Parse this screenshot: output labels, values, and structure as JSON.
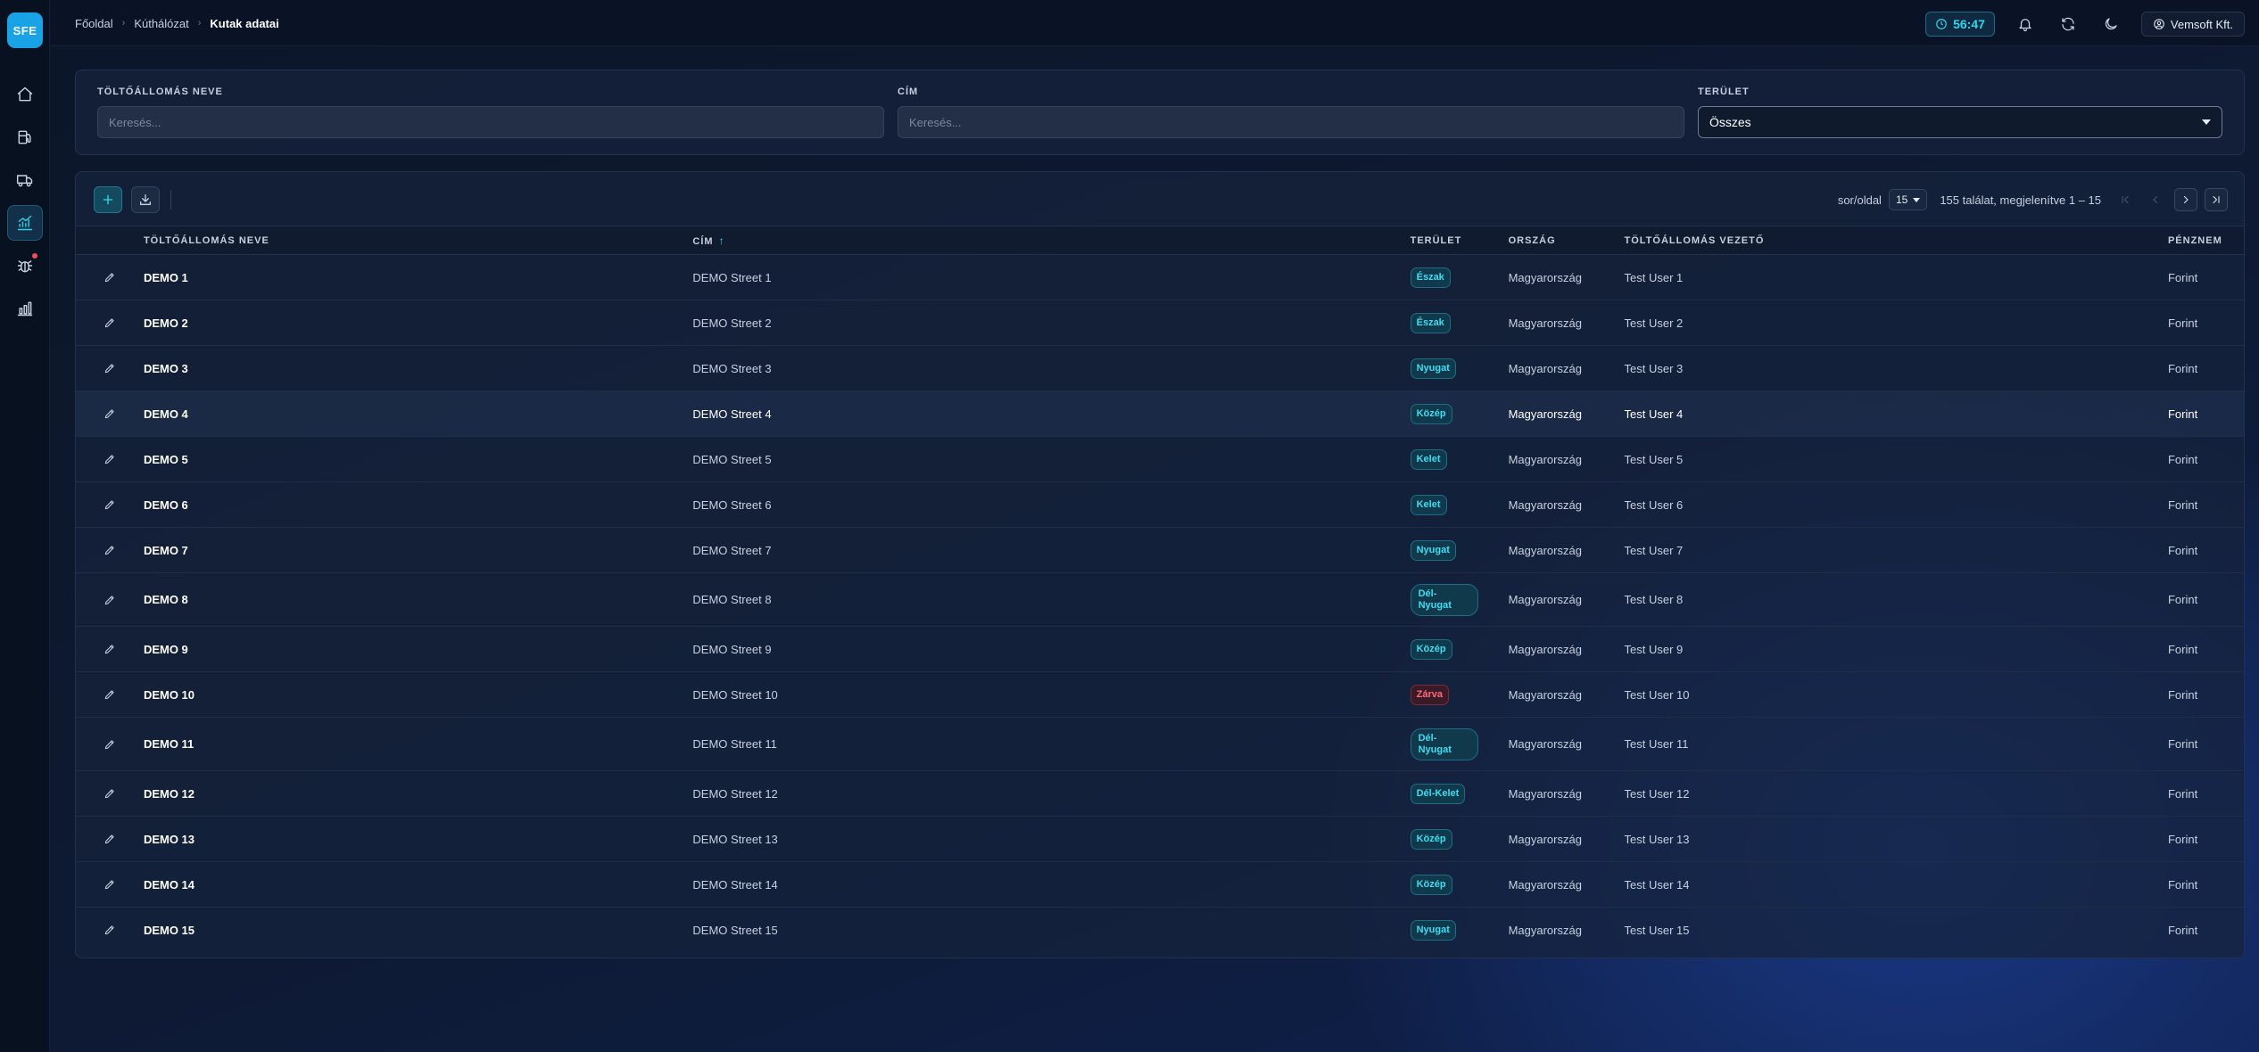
{
  "app": {
    "logo_text": "SFE"
  },
  "sidebar": {
    "items": [
      {
        "icon": "home-icon"
      },
      {
        "icon": "fuel-pump-icon"
      },
      {
        "icon": "truck-icon"
      },
      {
        "icon": "chart-up-icon",
        "active": true
      },
      {
        "icon": "bug-icon",
        "notification": true
      },
      {
        "icon": "bar-chart-icon"
      }
    ]
  },
  "header": {
    "breadcrumb": [
      "Főoldal",
      "Kúthálózat",
      "Kutak adatai"
    ],
    "timer": "56:47",
    "company": "Vemsoft Kft."
  },
  "filters": {
    "station_name": {
      "label": "Töltőállomás neve",
      "placeholder": "Keresés..."
    },
    "address": {
      "label": "Cím",
      "placeholder": "Keresés..."
    },
    "area": {
      "label": "Terület",
      "value": "Összes"
    }
  },
  "toolbar": {
    "rows_per_page_label": "sor/oldal",
    "rows_per_page": "15",
    "results": "155 találat, megjelenítve 1 – 15"
  },
  "table": {
    "columns": [
      "Töltőállomás neve",
      "Cím",
      "Terület",
      "Ország",
      "Töltőállomás vezető",
      "Pénznem"
    ],
    "rows": [
      {
        "name": "DEMO 1",
        "address": "DEMO Street 1",
        "area": "Észak",
        "country": "Magyarország",
        "manager": "Test User 1",
        "currency": "Forint"
      },
      {
        "name": "DEMO 2",
        "address": "DEMO Street 2",
        "area": "Észak",
        "country": "Magyarország",
        "manager": "Test User 2",
        "currency": "Forint"
      },
      {
        "name": "DEMO 3",
        "address": "DEMO Street 3",
        "area": "Nyugat",
        "country": "Magyarország",
        "manager": "Test User 3",
        "currency": "Forint"
      },
      {
        "name": "DEMO 4",
        "address": "DEMO Street 4",
        "area": "Közép",
        "country": "Magyarország",
        "manager": "Test User 4",
        "currency": "Forint"
      },
      {
        "name": "DEMO 5",
        "address": "DEMO Street 5",
        "area": "Kelet",
        "country": "Magyarország",
        "manager": "Test User 5",
        "currency": "Forint"
      },
      {
        "name": "DEMO 6",
        "address": "DEMO Street 6",
        "area": "Kelet",
        "country": "Magyarország",
        "manager": "Test User 6",
        "currency": "Forint"
      },
      {
        "name": "DEMO 7",
        "address": "DEMO Street 7",
        "area": "Nyugat",
        "country": "Magyarország",
        "manager": "Test User 7",
        "currency": "Forint"
      },
      {
        "name": "DEMO 8",
        "address": "DEMO Street 8",
        "area": "Dél-Nyugat",
        "country": "Magyarország",
        "manager": "Test User 8",
        "currency": "Forint"
      },
      {
        "name": "DEMO 9",
        "address": "DEMO Street 9",
        "area": "Közép",
        "country": "Magyarország",
        "manager": "Test User 9",
        "currency": "Forint"
      },
      {
        "name": "DEMO 10",
        "address": "DEMO Street 10",
        "area": "Zárva",
        "country": "Magyarország",
        "manager": "Test User 10",
        "currency": "Forint"
      },
      {
        "name": "DEMO 11",
        "address": "DEMO Street 11",
        "area": "Dél-Nyugat",
        "country": "Magyarország",
        "manager": "Test User 11",
        "currency": "Forint"
      },
      {
        "name": "DEMO 12",
        "address": "DEMO Street 12",
        "area": "Dél-Kelet",
        "country": "Magyarország",
        "manager": "Test User 12",
        "currency": "Forint"
      },
      {
        "name": "DEMO 13",
        "address": "DEMO Street 13",
        "area": "Közép",
        "country": "Magyarország",
        "manager": "Test User 13",
        "currency": "Forint"
      },
      {
        "name": "DEMO 14",
        "address": "DEMO Street 14",
        "area": "Közép",
        "country": "Magyarország",
        "manager": "Test User 14",
        "currency": "Forint"
      },
      {
        "name": "DEMO 15",
        "address": "DEMO Street 15",
        "area": "Nyugat",
        "country": "Magyarország",
        "manager": "Test User 15",
        "currency": "Forint"
      }
    ]
  },
  "colors": {
    "accent": "#35d8ef",
    "logo": "#19a3e6",
    "closed": "#ff6b7c"
  }
}
